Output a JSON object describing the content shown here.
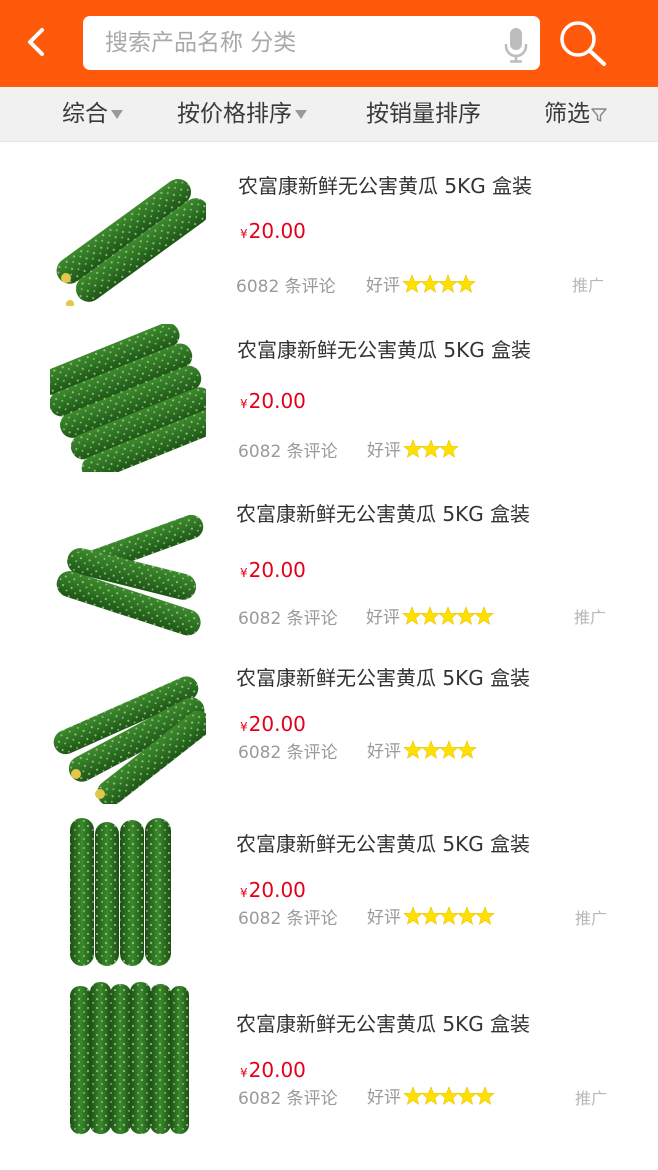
{
  "header": {
    "search_placeholder": "搜索产品名称 分类",
    "colors": {
      "brand": "#ff5a0c",
      "price": "#e4001b",
      "star": "#ffe000"
    }
  },
  "sort_bar": {
    "comprehensive": "综合",
    "by_price": "按价格排序",
    "by_sales": "按销量排序",
    "filter": "筛选"
  },
  "products": [
    {
      "title": "农富康新鲜无公害黄瓜 5KG 盒装",
      "currency": "¥",
      "price": "20.00",
      "reviews": "6082 条评论",
      "rating_label": "好评",
      "stars": 4,
      "promo": "推广"
    },
    {
      "title": "农富康新鲜无公害黄瓜 5KG 盒装",
      "currency": "¥",
      "price": "20.00",
      "reviews": "6082 条评论",
      "rating_label": "好评",
      "stars": 3,
      "promo": ""
    },
    {
      "title": "农富康新鲜无公害黄瓜 5KG 盒装",
      "currency": "¥",
      "price": "20.00",
      "reviews": "6082 条评论",
      "rating_label": "好评",
      "stars": 5,
      "promo": "推广"
    },
    {
      "title": "农富康新鲜无公害黄瓜 5KG 盒装",
      "currency": "¥",
      "price": "20.00",
      "reviews": "6082 条评论",
      "rating_label": "好评",
      "stars": 4,
      "promo": ""
    },
    {
      "title": "农富康新鲜无公害黄瓜 5KG 盒装",
      "currency": "¥",
      "price": "20.00",
      "reviews": "6082 条评论",
      "rating_label": "好评",
      "stars": 5,
      "promo": "推广"
    },
    {
      "title": "农富康新鲜无公害黄瓜 5KG 盒装",
      "currency": "¥",
      "price": "20.00",
      "reviews": "6082 条评论",
      "rating_label": "好评",
      "stars": 5,
      "promo": "推广"
    }
  ]
}
